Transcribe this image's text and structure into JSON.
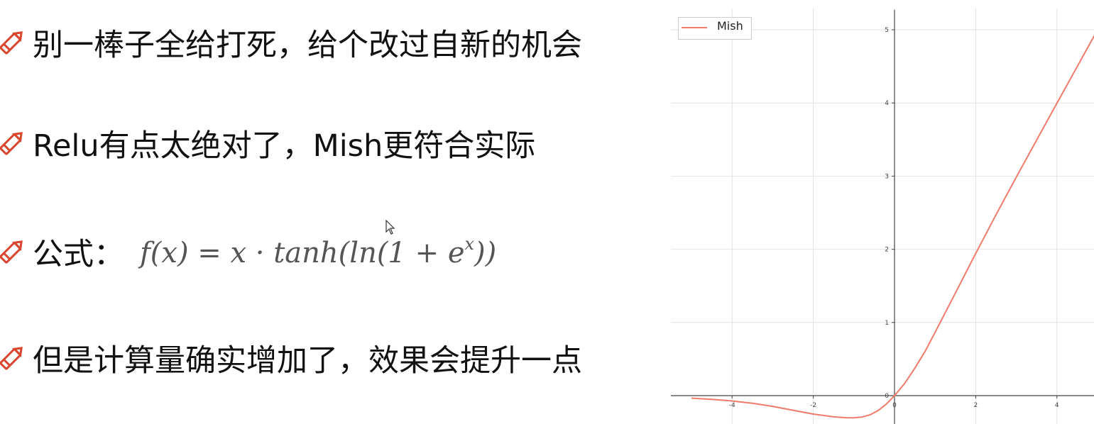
{
  "bullets": [
    {
      "text": "别一棒子全给打死，给个改过自新的机会",
      "icon": "pencil-icon"
    },
    {
      "text": "Relu有点太绝对了，Mish更符合实际",
      "icon": "pencil-icon"
    },
    {
      "text": "公式：",
      "formula": "f(x) = x · tanh(ln(1 + e",
      "formula_sup": "x",
      "formula_tail": "))",
      "icon": "pencil-icon"
    },
    {
      "text": "但是计算量确实增加了，效果会提升一点",
      "icon": "pencil-icon"
    }
  ],
  "colors": {
    "pencil": "#d9462e",
    "series": "#f07b6a",
    "grid": "#e2e2e2",
    "axis": "#444444"
  },
  "chart_data": {
    "type": "line",
    "title": "",
    "xlabel": "",
    "ylabel": "",
    "xlim": [
      -5,
      5
    ],
    "ylim": [
      -0.35,
      5.25
    ],
    "grid": true,
    "legend": "top-left",
    "x_ticks": [
      -4,
      -2,
      0,
      2,
      4
    ],
    "y_ticks": [
      0,
      1,
      2,
      3,
      4,
      5
    ],
    "series": [
      {
        "name": "Mish",
        "x": [
          -5,
          -4.5,
          -4,
          -3.5,
          -3,
          -2.5,
          -2,
          -1.5,
          -1.2,
          -1,
          -0.8,
          -0.6,
          -0.4,
          -0.2,
          0,
          0.25,
          0.5,
          0.75,
          1,
          1.5,
          2,
          2.5,
          3,
          3.5,
          4,
          4.5,
          5
        ],
        "y": [
          -0.034,
          -0.05,
          -0.073,
          -0.104,
          -0.146,
          -0.2,
          -0.252,
          -0.29,
          -0.301,
          -0.303,
          -0.293,
          -0.262,
          -0.203,
          -0.114,
          0,
          0.167,
          0.375,
          0.602,
          0.865,
          1.403,
          1.944,
          2.473,
          2.987,
          3.492,
          3.997,
          4.498,
          5.0
        ]
      }
    ]
  }
}
